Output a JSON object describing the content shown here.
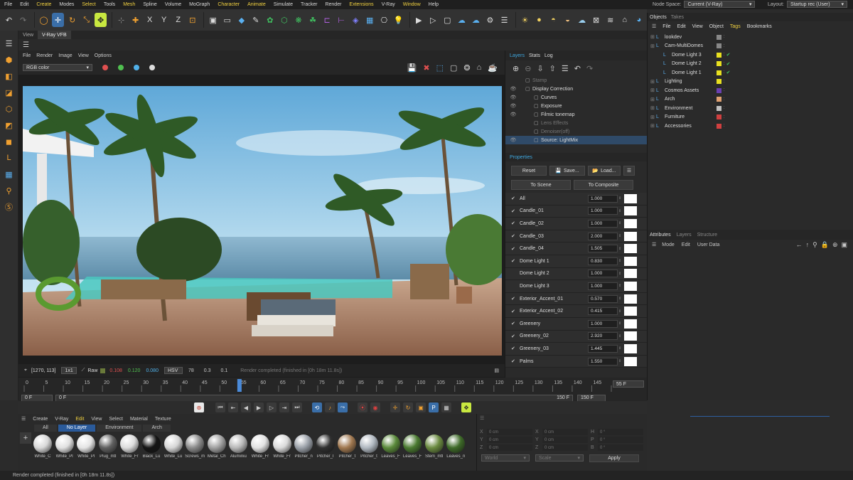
{
  "menu": {
    "items": [
      "File",
      "Edit",
      "Create",
      "Modes",
      "Select",
      "Tools",
      "Mesh",
      "Spline",
      "Volume",
      "MoGraph",
      "Character",
      "Animate",
      "Simulate",
      "Tracker",
      "Render",
      "Extensions",
      "V-Ray",
      "Window",
      "Help"
    ],
    "node_space_label": "Node Space:",
    "node_space_value": "Current (V-Ray)",
    "layout_label": "Layout:",
    "layout_value": "Startup rec (User)"
  },
  "view_tabs": [
    "View",
    "V-Ray VFB"
  ],
  "vfb": {
    "menu": [
      "File",
      "Render",
      "Image",
      "View",
      "Options"
    ],
    "channel": "RGB color",
    "status": {
      "coords": "[1270, 113]",
      "zoom": "1x1",
      "raw_label": "Raw",
      "r": "0.108",
      "g": "0.120",
      "b": "0.080",
      "mode": "HSV",
      "h": "78",
      "s": "0.3",
      "v": "0.1",
      "message": "Render completed (finished in [0h 18m 11.8s])"
    }
  },
  "layers_panel": {
    "tabs": [
      "Layers",
      "Stats",
      "Log"
    ],
    "tree": [
      {
        "label": "Stamp",
        "eye": false,
        "indent": 1,
        "dim": true
      },
      {
        "label": "Display Correction",
        "eye": true,
        "indent": 1,
        "dim": false
      },
      {
        "label": "Curves",
        "eye": true,
        "indent": 2,
        "dim": false
      },
      {
        "label": "Exposure",
        "eye": true,
        "indent": 2,
        "dim": false
      },
      {
        "label": "Filmic tonemap",
        "eye": true,
        "indent": 2,
        "dim": false
      },
      {
        "label": "Lens Effects",
        "eye": false,
        "indent": 2,
        "dim": true
      },
      {
        "label": "Denoiser(off)",
        "eye": false,
        "indent": 2,
        "dim": true
      },
      {
        "label": "Source: LightMix",
        "eye": true,
        "indent": 2,
        "dim": false,
        "selected": true
      }
    ],
    "properties_title": "Properties",
    "reset": "Reset",
    "save": "Save...",
    "load": "Load...",
    "to_scene": "To Scene",
    "to_composite": "To Composite",
    "lights": [
      {
        "name": "All",
        "value": "1.000",
        "checked": true
      },
      {
        "name": "Candle_01",
        "value": "1.000",
        "checked": true
      },
      {
        "name": "Candle_02",
        "value": "1.000",
        "checked": true
      },
      {
        "name": "Candle_03",
        "value": "2.000",
        "checked": true
      },
      {
        "name": "Candle_04",
        "value": "1.505",
        "checked": true
      },
      {
        "name": "Dome Light 1",
        "value": "0.830",
        "checked": true
      },
      {
        "name": "Dome Light 2",
        "value": "1.000",
        "checked": false
      },
      {
        "name": "Dome Light 3",
        "value": "1.000",
        "checked": false
      },
      {
        "name": "Exterior_Accent_01",
        "value": "0.570",
        "checked": true
      },
      {
        "name": "Exterior_Accent_02",
        "value": "0.415",
        "checked": true
      },
      {
        "name": "Greenery",
        "value": "1.000",
        "checked": true
      },
      {
        "name": "Greenery_02",
        "value": "2.920",
        "checked": true
      },
      {
        "name": "Greenery_03",
        "value": "1.445",
        "checked": true
      },
      {
        "name": "Palms",
        "value": "1.550",
        "checked": true
      }
    ]
  },
  "objects_panel": {
    "tabs": [
      "Objects",
      "Takes"
    ],
    "menu": [
      "File",
      "Edit",
      "View",
      "Object",
      "Tags",
      "Bookmarks"
    ],
    "rows": [
      {
        "name": "lookdev",
        "color": "#888888",
        "indent": 0
      },
      {
        "name": "Cam-MultiDomes",
        "color": "#888888",
        "indent": 0
      },
      {
        "name": "Dome Light 3",
        "color": "#e8e020",
        "indent": 1
      },
      {
        "name": "Dome Light 2",
        "color": "#e8e020",
        "indent": 1
      },
      {
        "name": "Dome Light 1",
        "color": "#e8e020",
        "indent": 1
      },
      {
        "name": "Lighting",
        "color": "#e8e020",
        "indent": 0
      },
      {
        "name": "Cosmos Assets",
        "color": "#6a3fb0",
        "indent": 0
      },
      {
        "name": "Arch",
        "color": "#e0a070",
        "indent": 0
      },
      {
        "name": "Environment",
        "color": "#c0c0c0",
        "indent": 0
      },
      {
        "name": "Furniture",
        "color": "#d04040",
        "indent": 0
      },
      {
        "name": "Accessories",
        "color": "#d04040",
        "indent": 0
      }
    ]
  },
  "attributes_panel": {
    "tabs": [
      "Attributes",
      "Layers",
      "Structure"
    ],
    "menu": [
      "Mode",
      "Edit",
      "User Data"
    ]
  },
  "timeline": {
    "ticks": [
      "0",
      "5",
      "10",
      "15",
      "20",
      "25",
      "30",
      "35",
      "40",
      "45",
      "50",
      "55",
      "60",
      "65",
      "70",
      "75",
      "80",
      "85",
      "90",
      "95",
      "100",
      "105",
      "110",
      "115",
      "120",
      "125",
      "130",
      "135",
      "140",
      "145",
      "150"
    ],
    "current": "55",
    "current_field": "55 F",
    "start": "0 F",
    "start2": "0 F",
    "end": "150 F",
    "end2": "150 F"
  },
  "material_panel": {
    "menu": [
      "Create",
      "V-Ray",
      "Edit",
      "View",
      "Select",
      "Material",
      "Texture"
    ],
    "filters": [
      "All",
      "No Layer",
      "Environment",
      "Arch"
    ],
    "materials": [
      {
        "name": "White_C",
        "color": "#d8d8d8"
      },
      {
        "name": "White_Pl",
        "color": "#e0e0e0"
      },
      {
        "name": "White_Pl",
        "color": "#e4e4e4"
      },
      {
        "name": "Plug_mtl",
        "color": "#606060"
      },
      {
        "name": "White_Fr",
        "color": "#dcdcdc"
      },
      {
        "name": "Black_Lu",
        "color": "#151515"
      },
      {
        "name": "White_Lu",
        "color": "#d6d6d6"
      },
      {
        "name": "Screws_m",
        "color": "#8a8a8a"
      },
      {
        "name": "Metal_Ch",
        "color": "#a0a0a0"
      },
      {
        "name": "Aluminiu",
        "color": "#b8b8b8"
      },
      {
        "name": "White_Fr",
        "color": "#e2e2e2"
      },
      {
        "name": "White_Fr",
        "color": "#dadada"
      },
      {
        "name": "Pitcher_n",
        "color": "#9aa0a8"
      },
      {
        "name": "Pitcher_I",
        "color": "#303030"
      },
      {
        "name": "Pitcher_t",
        "color": "#a07850"
      },
      {
        "name": "Pitcher_t",
        "color": "#b0b8c0"
      },
      {
        "name": "Leaves_F",
        "color": "#5a8a3a"
      },
      {
        "name": "Leaves_F",
        "color": "#4a7a30"
      },
      {
        "name": "Stem_mtl",
        "color": "#6a8a40"
      },
      {
        "name": "Leaves_n",
        "color": "#3e6a28"
      }
    ]
  },
  "coords_panel": {
    "rows": [
      {
        "a": "X",
        "av": "0 cm",
        "b": "X",
        "bv": "0 cm",
        "c": "H",
        "cv": "0 °"
      },
      {
        "a": "Y",
        "av": "0 cm",
        "b": "Y",
        "bv": "0 cm",
        "c": "P",
        "cv": "0 °"
      },
      {
        "a": "Z",
        "av": "0 cm",
        "b": "Z",
        "bv": "0 cm",
        "c": "B",
        "cv": "0 °"
      }
    ],
    "space": "World",
    "mode": "Scale",
    "apply": "Apply"
  },
  "statusbar": {
    "message": "Render completed (finished in [0h 18m 11.8s])"
  },
  "colors": {
    "accent": "#3fa8e0",
    "highlight": "#f0d040"
  }
}
